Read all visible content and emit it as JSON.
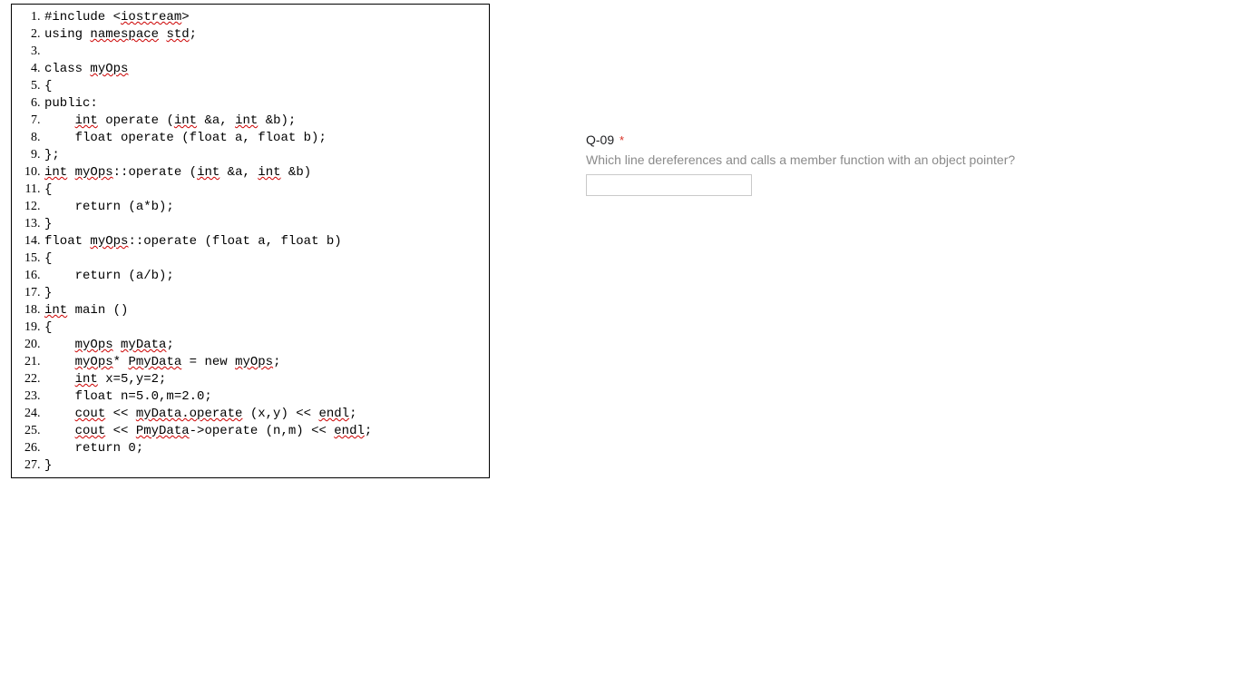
{
  "code": {
    "lines": [
      {
        "n": "1",
        "segs": [
          {
            "t": "#include <"
          },
          {
            "t": "iostream",
            "sq": true
          },
          {
            "t": ">"
          }
        ]
      },
      {
        "n": "2",
        "segs": [
          {
            "t": "using "
          },
          {
            "t": "namespace",
            "sq": true
          },
          {
            "t": " "
          },
          {
            "t": "std",
            "sq": true
          },
          {
            "t": ";"
          }
        ]
      },
      {
        "n": "3",
        "segs": [
          {
            "t": ""
          }
        ]
      },
      {
        "n": "4",
        "segs": [
          {
            "t": "class "
          },
          {
            "t": "myOps",
            "sq": true
          }
        ]
      },
      {
        "n": "5",
        "segs": [
          {
            "t": "{"
          }
        ]
      },
      {
        "n": "6",
        "segs": [
          {
            "t": "public:"
          }
        ]
      },
      {
        "n": "7",
        "segs": [
          {
            "t": "    "
          },
          {
            "t": "int",
            "sq": true
          },
          {
            "t": " operate ("
          },
          {
            "t": "int",
            "sq": true
          },
          {
            "t": " &a, "
          },
          {
            "t": "int",
            "sq": true
          },
          {
            "t": " &b);"
          }
        ]
      },
      {
        "n": "8",
        "segs": [
          {
            "t": "    float operate (float a, float b);"
          }
        ]
      },
      {
        "n": "9",
        "segs": [
          {
            "t": "};"
          }
        ]
      },
      {
        "n": "10",
        "segs": [
          {
            "t": "int",
            "sq": true
          },
          {
            "t": " "
          },
          {
            "t": "myOps",
            "sq": true
          },
          {
            "t": "::operate ("
          },
          {
            "t": "int",
            "sq": true
          },
          {
            "t": " &a, "
          },
          {
            "t": "int",
            "sq": true
          },
          {
            "t": " &b)"
          }
        ]
      },
      {
        "n": "11",
        "segs": [
          {
            "t": "{"
          }
        ]
      },
      {
        "n": "12",
        "segs": [
          {
            "t": "    return (a*b);"
          }
        ]
      },
      {
        "n": "13",
        "segs": [
          {
            "t": "}"
          }
        ]
      },
      {
        "n": "14",
        "segs": [
          {
            "t": "float "
          },
          {
            "t": "myOps",
            "sq": true
          },
          {
            "t": "::operate (float a, float b)"
          }
        ]
      },
      {
        "n": "15",
        "segs": [
          {
            "t": "{"
          }
        ]
      },
      {
        "n": "16",
        "segs": [
          {
            "t": "    return (a/b);"
          }
        ]
      },
      {
        "n": "17",
        "segs": [
          {
            "t": "}"
          }
        ]
      },
      {
        "n": "18",
        "segs": [
          {
            "t": "int",
            "sq": true
          },
          {
            "t": " main ()"
          }
        ]
      },
      {
        "n": "19",
        "segs": [
          {
            "t": "{"
          }
        ]
      },
      {
        "n": "20",
        "segs": [
          {
            "t": "    "
          },
          {
            "t": "myOps",
            "sq": true
          },
          {
            "t": " "
          },
          {
            "t": "myData",
            "sq": true
          },
          {
            "t": ";"
          }
        ]
      },
      {
        "n": "21",
        "segs": [
          {
            "t": "    "
          },
          {
            "t": "myOps",
            "sq": true
          },
          {
            "t": "* "
          },
          {
            "t": "PmyData",
            "sq": true
          },
          {
            "t": " = new "
          },
          {
            "t": "myOps",
            "sq": true
          },
          {
            "t": ";"
          }
        ]
      },
      {
        "n": "22",
        "segs": [
          {
            "t": "    "
          },
          {
            "t": "int",
            "sq": true
          },
          {
            "t": " x=5,y=2;"
          }
        ]
      },
      {
        "n": "23",
        "segs": [
          {
            "t": "    float n=5.0,m=2.0;"
          }
        ]
      },
      {
        "n": "24",
        "segs": [
          {
            "t": "    "
          },
          {
            "t": "cout",
            "sq": true
          },
          {
            "t": " << "
          },
          {
            "t": "myData.operate",
            "sq": true
          },
          {
            "t": " (x,y) << "
          },
          {
            "t": "endl",
            "sq": true
          },
          {
            "t": ";"
          }
        ]
      },
      {
        "n": "25",
        "segs": [
          {
            "t": "    "
          },
          {
            "t": "cout",
            "sq": true
          },
          {
            "t": " << "
          },
          {
            "t": "PmyData",
            "sq": true
          },
          {
            "t": "->operate (n,m) << "
          },
          {
            "t": "endl",
            "sq": true
          },
          {
            "t": ";"
          }
        ]
      },
      {
        "n": "26",
        "segs": [
          {
            "t": "    return 0;"
          }
        ]
      },
      {
        "n": "27",
        "segs": [
          {
            "t": "}"
          }
        ]
      }
    ]
  },
  "question": {
    "number": "Q-09",
    "required_marker": "*",
    "prompt": "Which line dereferences and calls a member function with an object pointer?",
    "answer_value": ""
  }
}
